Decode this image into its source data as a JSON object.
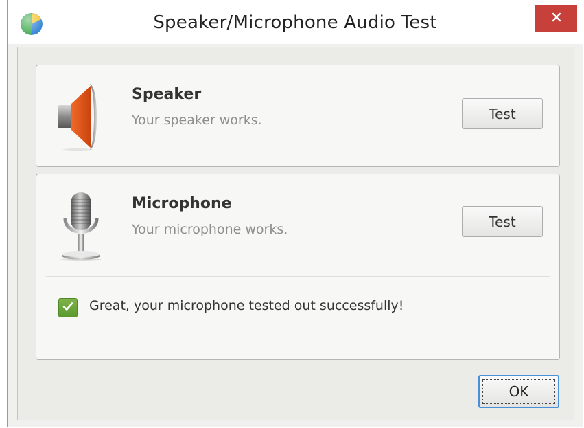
{
  "window": {
    "title": "Speaker/Microphone Audio Test",
    "icons": {
      "app": "globe-icon",
      "close": "close-icon"
    }
  },
  "speaker": {
    "name": "Speaker",
    "status": "Your speaker works.",
    "button_label": "Test",
    "icon": "speaker-icon"
  },
  "microphone": {
    "name": "Microphone",
    "status": "Your microphone works.",
    "button_label": "Test",
    "icon": "microphone-icon",
    "checked": true,
    "success_message": "Great, your microphone tested out successfully!"
  },
  "footer": {
    "ok_label": "OK"
  },
  "colors": {
    "close_button": "#c7413a",
    "speaker_cone": "#e0521a",
    "checkbox": "#6aa53a",
    "focus_border": "#4a90d9"
  }
}
